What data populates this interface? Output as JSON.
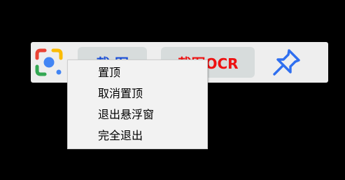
{
  "toolbar": {
    "screenshot_label": "截 图",
    "ocr_label": "截图OCR",
    "colors": {
      "screenshot_text": "#1b4fd6",
      "ocr_text": "#ee1111",
      "button_bg": "#d7dcdc",
      "toolbar_bg": "#eeeeee"
    },
    "icons": [
      "google-lens-icon",
      "pushpin-icon"
    ]
  },
  "context_menu": {
    "items": [
      {
        "label": "置顶"
      },
      {
        "label": "取消置顶"
      },
      {
        "label": "退出悬浮窗"
      },
      {
        "label": "完全退出"
      }
    ]
  }
}
